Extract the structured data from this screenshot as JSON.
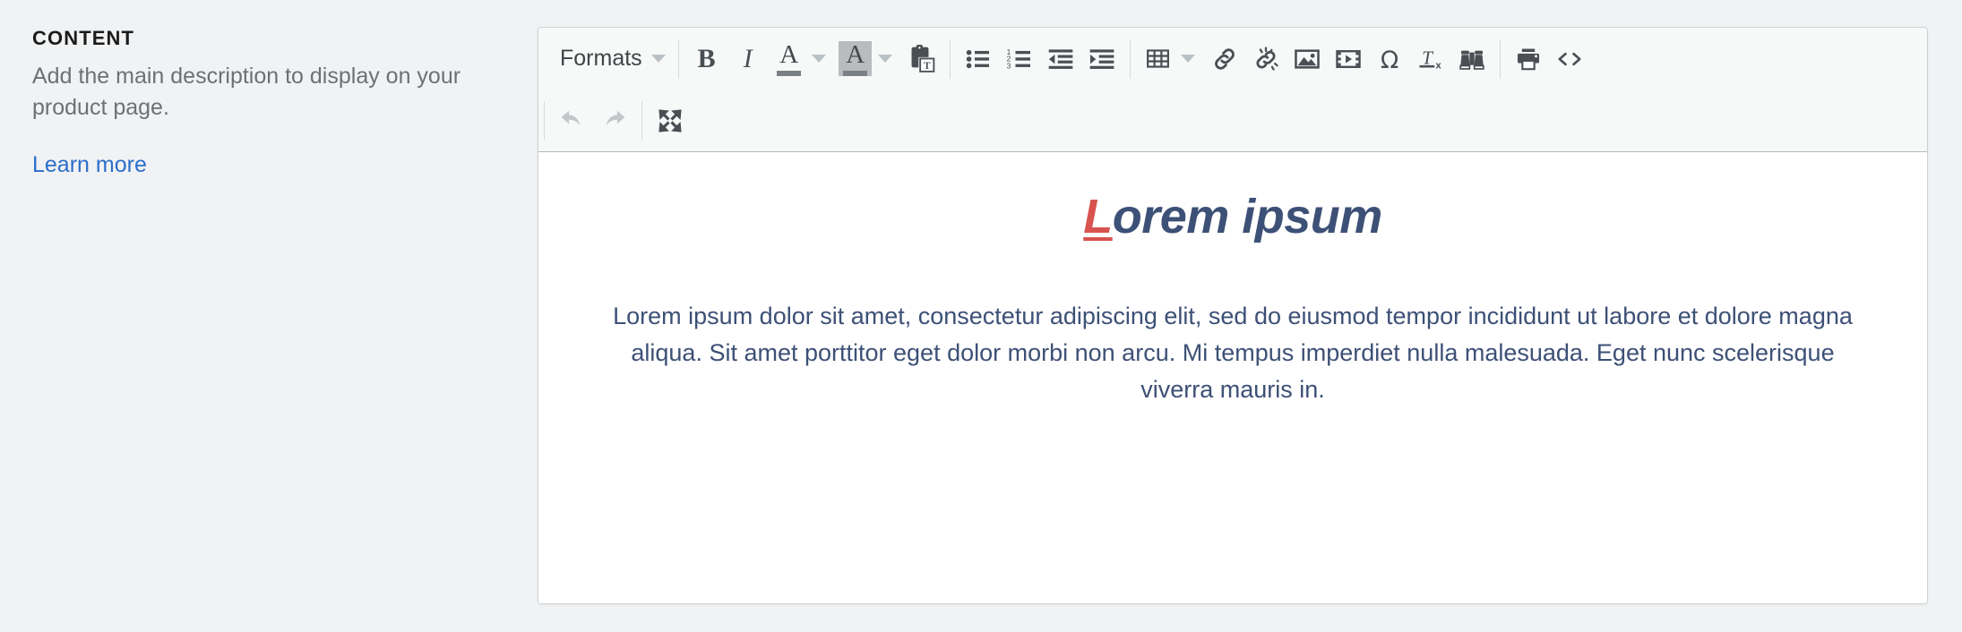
{
  "sidebar": {
    "title": "CONTENT",
    "description": "Add the main description to display on your product page.",
    "link_label": "Learn more",
    "link_color": "#2c6ecb",
    "title_color": "#1b1b1b",
    "description_color": "#6d7175"
  },
  "editor": {
    "toolbar": {
      "row1": [
        {
          "name": "formats-menu",
          "label": "Formats",
          "type": "text-dropdown"
        },
        {
          "name": "bold-button",
          "label": "B",
          "type": "bold"
        },
        {
          "name": "italic-button",
          "label": "I",
          "type": "italic"
        },
        {
          "name": "text-color-button",
          "label": "A",
          "type": "color-text"
        },
        {
          "name": "text-color-dropdown",
          "label": "",
          "type": "caret"
        },
        {
          "name": "background-color-button",
          "label": "A",
          "type": "color-background"
        },
        {
          "name": "background-color-dropdown",
          "label": "",
          "type": "caret"
        },
        {
          "name": "paste-as-text-button",
          "label": "Paste as text",
          "type": "icon"
        },
        {
          "name": "bullet-list-button",
          "label": "Bullet list",
          "type": "icon"
        },
        {
          "name": "numbered-list-button",
          "label": "Numbered list",
          "type": "icon"
        },
        {
          "name": "decrease-indent-button",
          "label": "Decrease indent",
          "type": "icon"
        },
        {
          "name": "increase-indent-button",
          "label": "Increase indent",
          "type": "icon"
        },
        {
          "name": "table-button",
          "label": "Table",
          "type": "icon"
        },
        {
          "name": "table-dropdown",
          "label": "",
          "type": "caret"
        },
        {
          "name": "insert-link-button",
          "label": "Insert link",
          "type": "icon"
        },
        {
          "name": "remove-link-button",
          "label": "Remove link",
          "type": "icon"
        },
        {
          "name": "insert-image-button",
          "label": "Insert image",
          "type": "icon"
        },
        {
          "name": "insert-media-button",
          "label": "Insert media",
          "type": "icon"
        },
        {
          "name": "special-character-button",
          "label": "Special character",
          "type": "icon"
        },
        {
          "name": "clear-formatting-button",
          "label": "Clear formatting",
          "type": "icon"
        },
        {
          "name": "find-replace-button",
          "label": "Find and replace",
          "type": "icon"
        },
        {
          "name": "print-button",
          "label": "Print",
          "type": "icon"
        },
        {
          "name": "source-code-button",
          "label": "Source code",
          "type": "icon"
        }
      ],
      "row2": [
        {
          "name": "undo-button",
          "label": "Undo",
          "type": "icon",
          "disabled": true
        },
        {
          "name": "redo-button",
          "label": "Redo",
          "type": "icon",
          "disabled": true
        },
        {
          "name": "fullscreen-button",
          "label": "Fullscreen",
          "type": "icon",
          "disabled": false
        }
      ]
    },
    "content": {
      "heading_dropcap": "L",
      "heading_rest": "orem ipsum",
      "heading_color": "#3d5076",
      "dropcap_color": "#d8534f",
      "body": "Lorem ipsum dolor sit amet, consectetur adipiscing elit, sed do eiusmod tempor incididunt ut labore et dolore magna aliqua. Sit amet porttitor eget dolor morbi non arcu. Mi tempus imperdiet nulla malesuada. Eget nunc scelerisque viverra mauris in.",
      "body_color": "#3d5076"
    }
  }
}
